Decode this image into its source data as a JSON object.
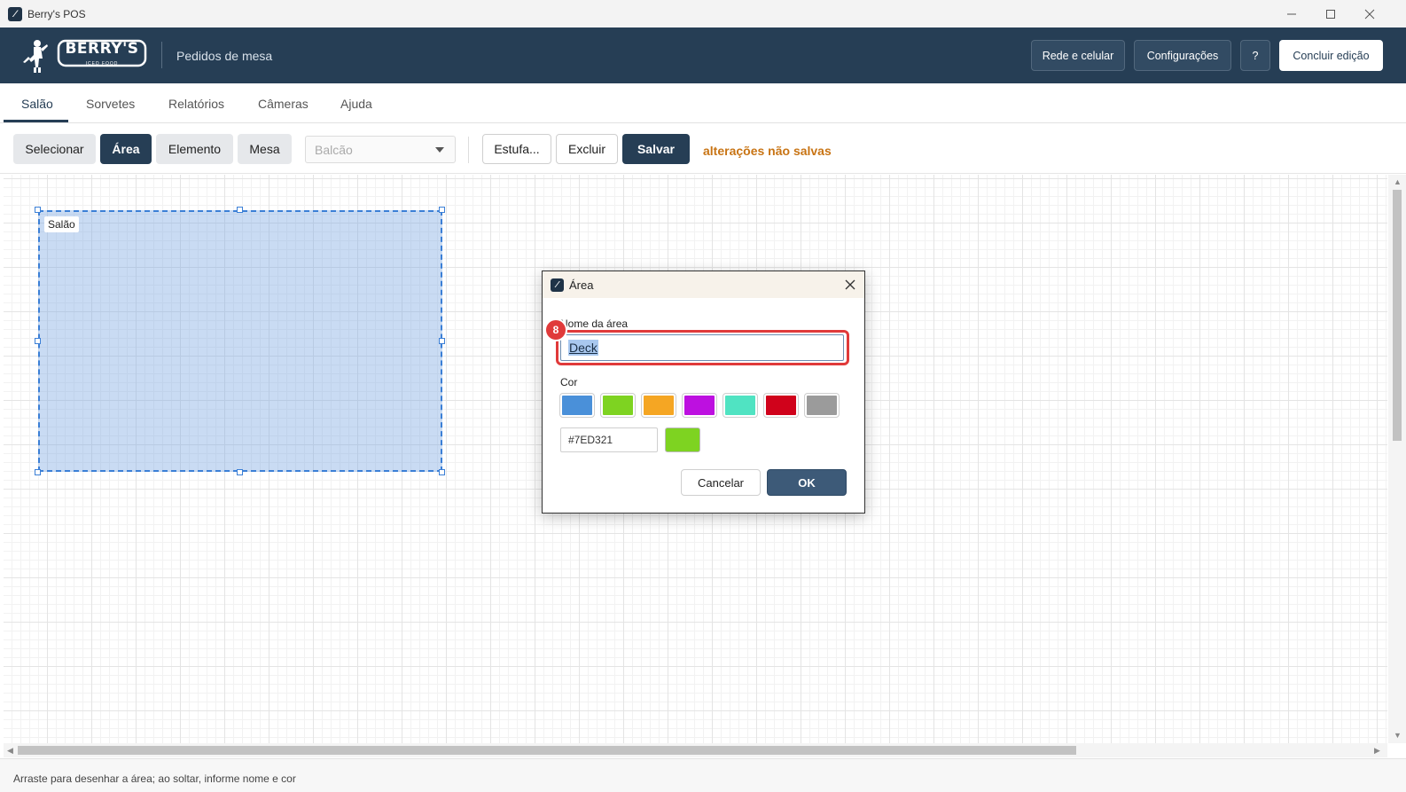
{
  "window": {
    "title": "Berry's POS",
    "app_icon_glyph": "⁄"
  },
  "header": {
    "logo_text": "BERRY'S",
    "logo_subtext": "ICED FOOD",
    "subtitle": "Pedidos de mesa",
    "buttons": {
      "network": "Rede e celular",
      "settings": "Configurações",
      "help": "?",
      "finish": "Concluir edição"
    }
  },
  "tabs": [
    "Salão",
    "Sorvetes",
    "Relatórios",
    "Câmeras",
    "Ajuda"
  ],
  "active_tab": "Salão",
  "toolbar": {
    "select_label": "Selecionar",
    "area_label": "Área",
    "element_label": "Elemento",
    "table_label": "Mesa",
    "dropdown_value": "Balcão",
    "stretch_label": "Estufa...",
    "delete_label": "Excluir",
    "save_label": "Salvar",
    "unsaved_text": "alterações não salvas"
  },
  "canvas": {
    "area_name": "Salão"
  },
  "dialog": {
    "title": "Área",
    "name_label": "Nome da área",
    "name_value": "Deck",
    "color_label": "Cor",
    "swatches": [
      "#4a90d9",
      "#7ed321",
      "#f5a623",
      "#bd10e0",
      "#50e3c2",
      "#d0021b",
      "#9b9b9b"
    ],
    "hex_value": "#7ED321",
    "preview_color": "#7ed321",
    "cancel_label": "Cancelar",
    "ok_label": "OK",
    "step_badge": "8"
  },
  "status": {
    "hint": "Arraste para desenhar a área; ao soltar, informe nome e cor"
  }
}
